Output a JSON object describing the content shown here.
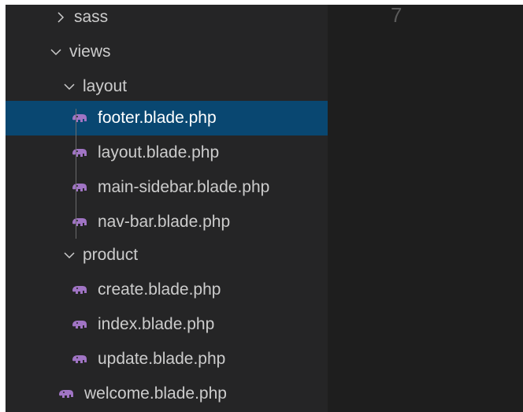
{
  "explorer": {
    "items": [
      {
        "label": "sass",
        "type": "folder",
        "expanded": false,
        "depth": 0
      },
      {
        "label": "views",
        "type": "folder",
        "expanded": true,
        "depth": 0
      },
      {
        "label": "layout",
        "type": "folder",
        "expanded": true,
        "depth": 1
      },
      {
        "label": "footer.blade.php",
        "type": "file",
        "depth": 2,
        "selected": true
      },
      {
        "label": "layout.blade.php",
        "type": "file",
        "depth": 2
      },
      {
        "label": "main-sidebar.blade.php",
        "type": "file",
        "depth": 2
      },
      {
        "label": "nav-bar.blade.php",
        "type": "file",
        "depth": 2
      },
      {
        "label": "product",
        "type": "folder",
        "expanded": true,
        "depth": 1
      },
      {
        "label": "create.blade.php",
        "type": "file",
        "depth": 2
      },
      {
        "label": "index.blade.php",
        "type": "file",
        "depth": 2
      },
      {
        "label": "update.blade.php",
        "type": "file",
        "depth": 2
      },
      {
        "label": "welcome.blade.php",
        "type": "file",
        "depth": 1
      }
    ]
  },
  "editor": {
    "line_number": "7"
  },
  "colors": {
    "selection": "#094771",
    "php_icon": "#a074c4",
    "sidebar_bg": "#252526",
    "editor_bg": "#1e1e1e",
    "text": "#cccccc"
  }
}
